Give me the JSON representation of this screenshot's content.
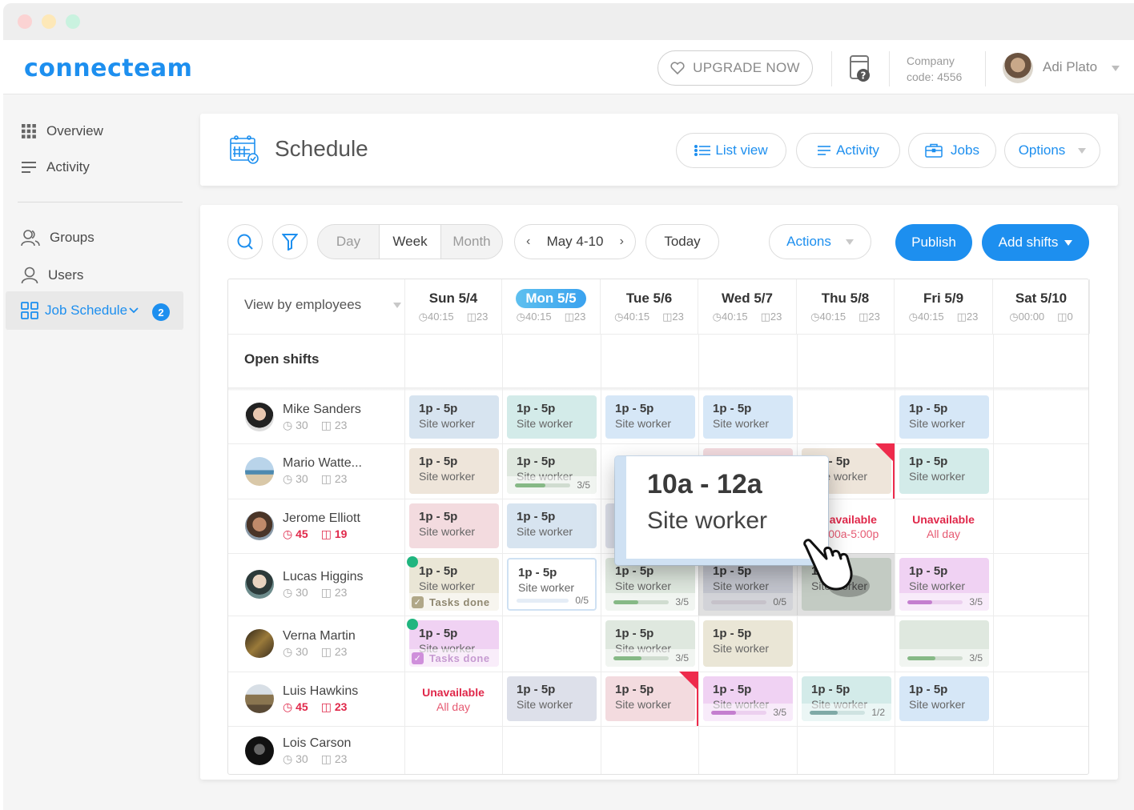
{
  "window": {
    "traffic_lights": [
      "#fbd3d3",
      "#fde8b8",
      "#c9f2df"
    ]
  },
  "topbar": {
    "logo": "connecteam",
    "upgrade_label": "UPGRADE NOW",
    "company_label": "Company",
    "company_code": "code: 4556",
    "user_name": "Adi Plato"
  },
  "sidebar": {
    "items": [
      {
        "label": "Overview",
        "icon": "grid-icon"
      },
      {
        "label": "Activity",
        "icon": "lines-icon"
      },
      {
        "label": "Groups",
        "icon": "users-group-icon"
      },
      {
        "label": "Users",
        "icon": "user-icon"
      },
      {
        "label": "Job Schedule",
        "icon": "schedule-grid-icon",
        "badge": "2",
        "active": true
      }
    ]
  },
  "header": {
    "title": "Schedule",
    "buttons": {
      "list_view": "List view",
      "activity": "Activity",
      "jobs": "Jobs",
      "options": "Options"
    }
  },
  "toolbar": {
    "view_modes": [
      "Day",
      "Week",
      "Month"
    ],
    "selected_view": "Week",
    "date_range": "May 4-10",
    "today": "Today",
    "actions": "Actions",
    "publish": "Publish",
    "add_shifts": "Add shifts"
  },
  "grid": {
    "view_by": "View by employees",
    "open_shifts_label": "Open shifts",
    "days": [
      {
        "label": "Sun 5/4",
        "hours": "40:15",
        "shifts": "23"
      },
      {
        "label": "Mon 5/5",
        "hours": "40:15",
        "shifts": "23",
        "today": true
      },
      {
        "label": "Tue 5/6",
        "hours": "40:15",
        "shifts": "23"
      },
      {
        "label": "Wed 5/7",
        "hours": "40:15",
        "shifts": "23"
      },
      {
        "label": "Thu 5/8",
        "hours": "40:15",
        "shifts": "23"
      },
      {
        "label": "Fri 5/9",
        "hours": "40:15",
        "shifts": "23"
      },
      {
        "label": "Sat 5/10",
        "hours": "00:00",
        "shifts": "0"
      }
    ],
    "employees": [
      {
        "name": "Mike Sanders",
        "hours": "30",
        "shifts": "23",
        "warn": false
      },
      {
        "name": "Mario Watte...",
        "hours": "30",
        "shifts": "23",
        "warn": false
      },
      {
        "name": "Jerome Elliott",
        "hours": "45",
        "shifts": "19",
        "warn": true
      },
      {
        "name": "Lucas Higgins",
        "hours": "30",
        "shifts": "23",
        "warn": false
      },
      {
        "name": "Verna Martin",
        "hours": "30",
        "shifts": "23",
        "warn": false
      },
      {
        "name": "Luis Hawkins",
        "hours": "45",
        "shifts": "23",
        "warn": true
      },
      {
        "name": "Lois Carson",
        "hours": "30",
        "shifts": "23",
        "warn": false
      }
    ],
    "shift_time": "1p - 5p",
    "shift_role": "Site worker",
    "unavailable": "Unavailable",
    "all_day": "All day",
    "partial_unavailable_time": "10:00a-5:00p",
    "tasks_done": "Tasks done",
    "progress": {
      "mario_mon": "3/5",
      "lucas_mon": "0/5",
      "lucas_tue": "3/5",
      "lucas_wed": "0/5",
      "lucas_fri": "3/5",
      "verna_tue": "3/5",
      "verna_fri": "3/5",
      "luis_wed": "3/5",
      "luis_thu": "1/2"
    }
  },
  "popup": {
    "time": "10a - 12a",
    "role": "Site worker"
  },
  "colors": {
    "accent": "#1d8fef",
    "danger": "#e0284a",
    "success": "#20b57f"
  }
}
